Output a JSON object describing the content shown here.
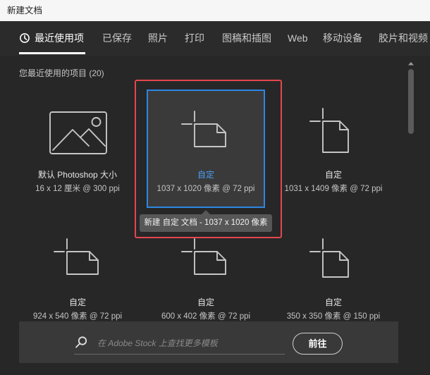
{
  "window": {
    "title": "新建文档"
  },
  "tabs": [
    {
      "label": "最近使用项",
      "icon": "clock-icon",
      "active": true
    },
    {
      "label": "已保存"
    },
    {
      "label": "照片"
    },
    {
      "label": "打印"
    },
    {
      "label": "图稿和插图"
    },
    {
      "label": "Web"
    },
    {
      "label": "移动设备"
    },
    {
      "label": "胶片和视频"
    }
  ],
  "recent": {
    "heading": "您最近使用的项目 (20)",
    "items": [
      {
        "name": "默认 Photoshop 大小",
        "size": "16 x 12 厘米 @ 300 ppi",
        "icon": "image-placeholder-icon"
      },
      {
        "name": "自定",
        "size": "1037 x 1020 像素 @ 72 ppi",
        "icon": "blank-document-icon",
        "selected": true
      },
      {
        "name": "自定",
        "size": "1031 x 1409 像素 @ 72 ppi",
        "icon": "blank-document-icon"
      },
      {
        "name": "自定",
        "size": "924 x 540 像素 @ 72 ppi",
        "icon": "blank-document-icon"
      },
      {
        "name": "自定",
        "size": "600 x 402 像素 @ 72 ppi",
        "icon": "blank-document-icon"
      },
      {
        "name": "自定",
        "size": "350 x 350 像素 @ 150 ppi",
        "icon": "blank-document-icon"
      }
    ]
  },
  "tooltip": {
    "text": "新建 自定 文档 - 1037 x 1020 像素"
  },
  "stock_search": {
    "icon": "search-icon",
    "placeholder": "在 Adobe Stock 上查找更多模板",
    "value": "",
    "button_label": "前往"
  },
  "scrollbar": {
    "icon": "scroll-up-arrow-icon"
  },
  "colors": {
    "accent": "#2d87e2",
    "selected_label": "#4aa0f5",
    "annotation": "#e5464f"
  }
}
